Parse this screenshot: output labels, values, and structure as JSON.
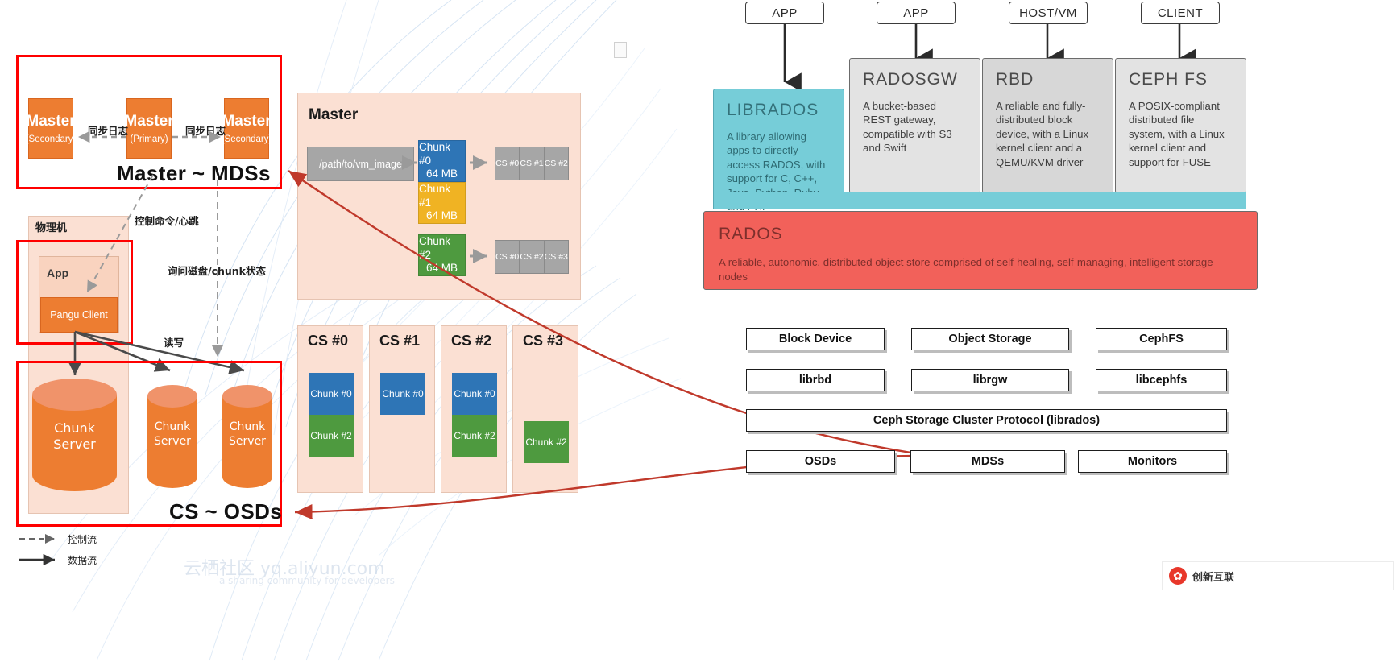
{
  "pangu": {
    "masters": [
      {
        "title": "Master",
        "role": "(Secondary)"
      },
      {
        "title": "Master",
        "role": "(Primary)"
      },
      {
        "title": "Master",
        "role": "(Secondary)"
      }
    ],
    "sync_label_left": "同步日志",
    "sync_label_right": "同步日志",
    "annotation_master": "Master ~ MDSs",
    "annotation_cs": "CS ~ OSDs",
    "host_label": "物理机",
    "app_label": "App",
    "client_label": "Pangu Client",
    "edge_control": "控制命令/心跳",
    "edge_query": "询问磁盘/chunk状态",
    "edge_rw": "读写",
    "chunk_servers": [
      {
        "line1": "Chunk",
        "line2": "Server"
      },
      {
        "line1": "Chunk",
        "line2": "Server"
      },
      {
        "line1": "Chunk",
        "line2": "Server"
      }
    ],
    "legend": [
      {
        "label": "控制流",
        "style": "dashed"
      },
      {
        "label": "数据流",
        "style": "solid"
      }
    ]
  },
  "master_panel": {
    "title": "Master",
    "path": "/path/to/vm_image",
    "chunks": [
      {
        "name": "Chunk #0",
        "size": "64 MB",
        "color": "blue"
      },
      {
        "name": "Chunk #1",
        "size": "64 MB",
        "color": "amber"
      },
      {
        "name": "Chunk #2",
        "size": "64 MB",
        "color": "green"
      }
    ],
    "replica_row_top": [
      "CS #0",
      "CS #1",
      "CS #2"
    ],
    "replica_row_bottom": [
      "CS #0",
      "CS #2",
      "CS #3"
    ]
  },
  "cs_panels": [
    {
      "header": "CS #0",
      "chunks": [
        {
          "label": "Chunk #0",
          "color": "blue"
        },
        {
          "label": "Chunk #2",
          "color": "green"
        }
      ]
    },
    {
      "header": "CS #1",
      "chunks": [
        {
          "label": "Chunk #0",
          "color": "blue"
        }
      ]
    },
    {
      "header": "CS #2",
      "chunks": [
        {
          "label": "Chunk #0",
          "color": "blue"
        },
        {
          "label": "Chunk #2",
          "color": "green"
        }
      ]
    },
    {
      "header": "CS #3",
      "chunks": [
        {
          "label": "Chunk #2",
          "color": "green"
        }
      ]
    }
  ],
  "ceph": {
    "clients": [
      "APP",
      "APP",
      "HOST/VM",
      "CLIENT"
    ],
    "services": [
      {
        "title": "LIBRADOS",
        "desc": "A library allowing apps to directly access RADOS, with support for C, C++, Java, Python, Ruby, and PHP",
        "variant": "librados"
      },
      {
        "title": "RADOSGW",
        "desc": "A bucket-based REST gateway, compatible with S3 and Swift",
        "variant": "grey"
      },
      {
        "title": "RBD",
        "desc": "A reliable and fully-distributed block device, with a Linux kernel client and a QEMU/KVM driver",
        "variant": "grey-dark"
      },
      {
        "title": "CEPH FS",
        "desc": "A POSIX-compliant distributed file system, with a Linux kernel client and support for FUSE",
        "variant": "grey"
      }
    ],
    "rados": {
      "title": "RADOS",
      "desc": "A reliable, autonomic, distributed object store comprised of self-healing, self-managing, intelligent storage nodes"
    }
  },
  "ceph_stack": {
    "row1": [
      "Block Device",
      "Object Storage",
      "CephFS"
    ],
    "row2": [
      "librbd",
      "librgw",
      "libcephfs"
    ],
    "protocol": "Ceph Storage Cluster Protocol (librados)",
    "row3": [
      "OSDs",
      "MDSs",
      "Monitors"
    ]
  },
  "watermark": {
    "line1": "云栖社区 yq.aliyun.com",
    "line2": "a sharing community for developers"
  },
  "brand": {
    "icon": "creative-logo-icon",
    "text": "创新互联"
  },
  "colors": {
    "orange": "#ED7D31",
    "red_frame": "#FF0000",
    "red_arrow": "#C0392B",
    "chunk_blue": "#2E75B6",
    "chunk_amber": "#F0B323",
    "chunk_green": "#4E9A3F",
    "librados_cyan": "#76CDD8",
    "rados_red": "#F2615A",
    "peach": "#FBE0D3"
  }
}
